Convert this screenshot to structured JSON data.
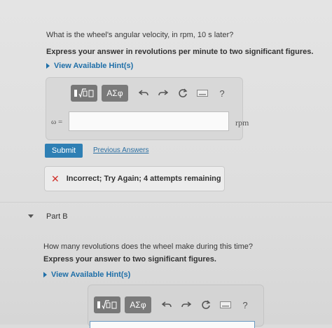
{
  "partA": {
    "question": "What is the wheel's angular velocity, in rpm, 10 s later?",
    "instruction": "Express your answer in revolutions per minute to two significant figures.",
    "hint_label": "View Available Hint(s)",
    "toolbar": {
      "templates_icon": "template-sqrt-icon",
      "greek_label": "ΑΣφ",
      "undo_icon": "undo-icon",
      "redo_icon": "redo-icon",
      "reset_icon": "reset-icon",
      "keyboard_icon": "keyboard-icon",
      "help_label": "?"
    },
    "variable_label": "ω =",
    "input_value": "",
    "unit": "rpm",
    "submit_label": "Submit",
    "previous_answers_label": "Previous Answers",
    "feedback": {
      "icon": "x-mark-icon",
      "text": "Incorrect; Try Again; 4 attempts remaining",
      "color": "#d0302a"
    }
  },
  "partB": {
    "title": "Part B",
    "question": "How many revolutions does the wheel make during this time?",
    "instruction": "Express your answer to two significant figures.",
    "hint_label": "View Available Hint(s)",
    "toolbar": {
      "greek_label": "ΑΣφ",
      "help_label": "?"
    }
  },
  "colors": {
    "accent": "#2e7fb4",
    "link": "#1f6fa8",
    "error": "#d0302a"
  }
}
